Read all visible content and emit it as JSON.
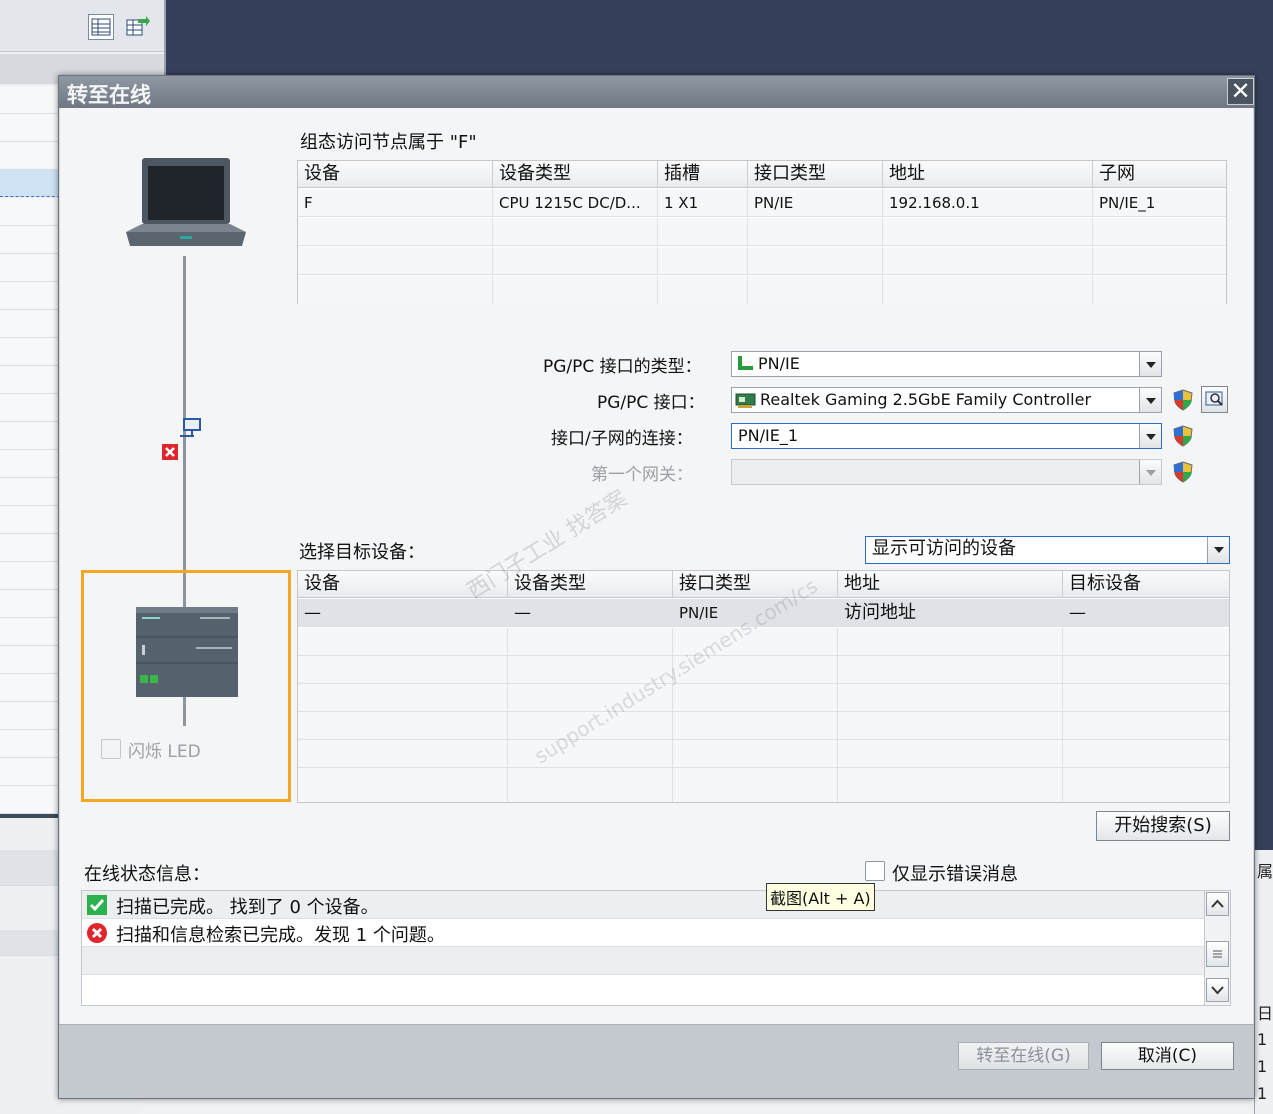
{
  "dialog": {
    "title": "转至在线",
    "close_symbol": "✕"
  },
  "configured_nodes": {
    "caption": "组态访问节点属于 \"F\"",
    "columns": [
      "设备",
      "设备类型",
      "插槽",
      "接口类型",
      "地址",
      "子网"
    ],
    "rows": [
      [
        "F",
        "CPU 1215C DC/D...",
        "1 X1",
        "PN/IE",
        "192.168.0.1",
        "PN/IE_1"
      ],
      [
        "",
        "",
        "",
        "",
        "",
        ""
      ],
      [
        "",
        "",
        "",
        "",
        "",
        ""
      ],
      [
        "",
        "",
        "",
        "",
        "",
        ""
      ]
    ]
  },
  "interface": {
    "type_label": "PG/PC 接口的类型：",
    "type_value": "PN/IE",
    "interface_label": "PG/PC 接口：",
    "interface_value": "Realtek Gaming 2.5GbE Family Controller",
    "subnet_label": "接口/子网的连接：",
    "subnet_value": "PN/IE_1",
    "gateway_label": "第一个网关：",
    "gateway_value": ""
  },
  "target": {
    "label": "选择目标设备：",
    "filter_value": "显示可访问的设备",
    "columns": [
      "设备",
      "设备类型",
      "接口类型",
      "地址",
      "目标设备"
    ],
    "rows": [
      [
        "—",
        "—",
        "PN/IE",
        "访问地址",
        "—"
      ],
      [
        "",
        "",
        "",
        "",
        ""
      ],
      [
        "",
        "",
        "",
        "",
        ""
      ],
      [
        "",
        "",
        "",
        "",
        ""
      ],
      [
        "",
        "",
        "",
        "",
        ""
      ],
      [
        "",
        "",
        "",
        "",
        ""
      ],
      [
        "",
        "",
        "",
        "",
        ""
      ]
    ]
  },
  "flash_led_label": "闪烁 LED",
  "start_search_label": "开始搜索(S)",
  "status": {
    "label": "在线状态信息：",
    "only_errors_label": "仅显示错误消息",
    "messages": [
      {
        "icon": "success-check-icon",
        "text": "扫描已完成。 找到了 0 个设备。"
      },
      {
        "icon": "error-x-icon",
        "text": "扫描和信息检索已完成。发现 1 个问题。"
      }
    ]
  },
  "tooltip": "截图(Alt + A)",
  "footer": {
    "go_online_label": "转至在线(G)",
    "cancel_label": "取消(C)"
  },
  "watermark": {
    "line1": "西门子工业  找答案",
    "line2": "support.industry.siemens.com/cs"
  },
  "background": {
    "right_fragments": [
      "属",
      "日",
      "1",
      "1",
      "1"
    ]
  },
  "colors": {
    "selection_frame": "#f5a623",
    "success": "#2bb24c",
    "error": "#e0262d"
  }
}
